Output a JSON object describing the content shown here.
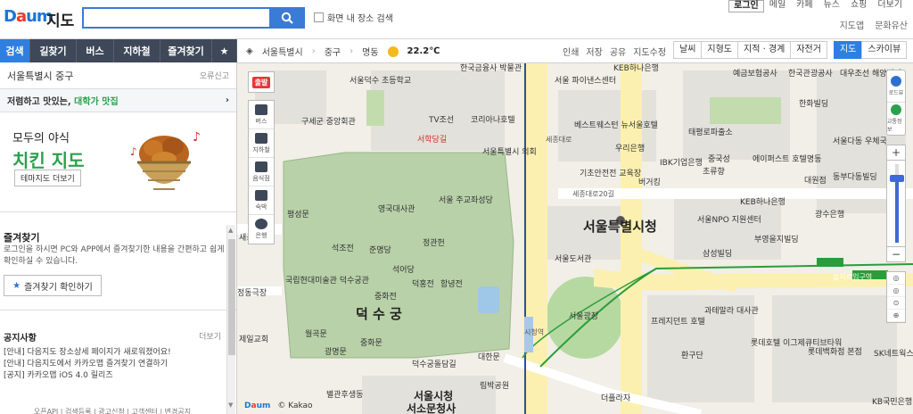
{
  "header": {
    "logo_text": "Daum",
    "title": "지도",
    "search": {
      "placeholder": "",
      "value": ""
    },
    "checkbox_label": "화면 내 장소 검색",
    "topnav": [
      "로그인",
      "메일",
      "카페",
      "뉴스",
      "쇼핑",
      "더보기"
    ],
    "topnav2": [
      "지도앱",
      "문화유산"
    ]
  },
  "lefttabs": [
    "검색",
    "길찾기",
    "버스",
    "지하철",
    "즐겨찾기"
  ],
  "leftpanel": {
    "location": "서울특별시 중구",
    "report": "오류신고",
    "promo_prefix": "저렴하고 맛있는, ",
    "promo_highlight": "대학가 맛집",
    "banner_line1": "모두의 야식",
    "banner_line2": "치킨 지도",
    "banner_button": "테마지도 더보기",
    "fav_title": "즐겨찾기",
    "fav_desc": "로그인을 하시면 PC와 APP에서 즐겨찾기한 내용을 간편하고 쉽게 확인하실 수 있습니다.",
    "fav_button": "즐겨찾기 확인하기",
    "notice_title": "공지사항",
    "notice_more": "더보기",
    "notices": [
      "[안내] 다음지도 장소상세 페이지가 새로워졌어요!",
      "[안내] 다음지도에서 카카오맵 즐겨찾기 연결하기",
      "[공지] 카카오맵 iOS 4.0 릴리즈"
    ],
    "footer": "오픈API | 검색등록 | 광고신청 | 고객센터 | 변경공지"
  },
  "toolbar": {
    "crumbs": [
      "서울특별시",
      "중구",
      "명동"
    ],
    "temperature": "22.2℃",
    "actions": [
      "인쇄",
      "저장",
      "공유",
      "지도수정"
    ],
    "layers": [
      "날씨",
      "지형도",
      "지적 · 경계",
      "자전거"
    ],
    "maptypes": [
      "지도",
      "스카이뷰"
    ]
  },
  "maptools": {
    "start_label": "출발",
    "items": [
      "버스",
      "지하철",
      "음식점",
      "숙박",
      "은행"
    ]
  },
  "zoomtools": {
    "roadview": "로드뷰",
    "traffic": "교통정보",
    "plus": "+",
    "minus": "−"
  },
  "map": {
    "labels": [
      {
        "id": "deoksugung",
        "text": "덕 수 궁",
        "cls": "big"
      },
      {
        "id": "cityhall",
        "text": "서울특별시청",
        "cls": "big"
      },
      {
        "id": "seoulcityhall_station",
        "text": "서울시청",
        "cls": "med"
      },
      {
        "id": "seosomun",
        "text": "서소문청사",
        "cls": "med"
      },
      {
        "id": "euljiro",
        "text": "을지로입구역",
        "cls": "road"
      },
      {
        "id": "hgbm",
        "text": "한국금융사 박물관",
        "cls": ""
      },
      {
        "id": "deoksu_school",
        "text": "서울덕수 초등학교",
        "cls": ""
      },
      {
        "id": "guse",
        "text": "구세군 중앙회관",
        "cls": ""
      },
      {
        "id": "tvchosun",
        "text": "TV조선",
        "cls": ""
      },
      {
        "id": "korea_press",
        "text": "코리아나호텔",
        "cls": ""
      },
      {
        "id": "seohakdanggil",
        "text": "서학당길",
        "cls": ""
      },
      {
        "id": "seoul_council",
        "text": "서울특별시 의회",
        "cls": ""
      },
      {
        "id": "finance_center",
        "text": "서울 파이낸스센터",
        "cls": ""
      },
      {
        "id": "kebhana",
        "text": "KEB하나은행",
        "cls": ""
      },
      {
        "id": "yegeum",
        "text": "예금보험공사",
        "cls": ""
      },
      {
        "id": "hankuk",
        "text": "한국관광공사",
        "cls": ""
      },
      {
        "id": "daewoo",
        "text": "대우조선 해양빌딩",
        "cls": ""
      },
      {
        "id": "hanwha",
        "text": "한화빌딩",
        "cls": ""
      },
      {
        "id": "westin",
        "text": "베스트웨스턴 뉴서울호텔",
        "cls": ""
      },
      {
        "id": "woori",
        "text": "우리은행",
        "cls": ""
      },
      {
        "id": "taepyeong",
        "text": "태평로파출소",
        "cls": ""
      },
      {
        "id": "kiki",
        "text": "기초안전전 교육장",
        "cls": ""
      },
      {
        "id": "ibk",
        "text": "IBK기업은행",
        "cls": ""
      },
      {
        "id": "burger",
        "text": "버거킹",
        "cls": ""
      },
      {
        "id": "joonggukseong",
        "text": "중국성",
        "cls": ""
      },
      {
        "id": "chorongbang",
        "text": "초류향",
        "cls": ""
      },
      {
        "id": "ace",
        "text": "에이퍼스트 호텔명동",
        "cls": ""
      },
      {
        "id": "seoul_dadong",
        "text": "서울다동 우체국",
        "cls": ""
      },
      {
        "id": "dongbu",
        "text": "동부다동빌딩",
        "cls": ""
      },
      {
        "id": "daewon",
        "text": "대원점",
        "cls": ""
      },
      {
        "id": "sejong20",
        "text": "세종대로20길",
        "cls": "road"
      },
      {
        "id": "kebhana2",
        "text": "KEB하나은행",
        "cls": ""
      },
      {
        "id": "gwangsu",
        "text": "광수은행",
        "cls": ""
      },
      {
        "id": "yeongguk",
        "text": "영국대사관",
        "cls": ""
      },
      {
        "id": "seoul_jugyo",
        "text": "서울 주교좌성당",
        "cls": ""
      },
      {
        "id": "jeonggwanheon",
        "text": "정관헌",
        "cls": ""
      },
      {
        "id": "seokjojeon",
        "text": "석조전",
        "cls": ""
      },
      {
        "id": "junmyeongdang",
        "text": "준명당",
        "cls": ""
      },
      {
        "id": "seokeodang",
        "text": "석어당",
        "cls": ""
      },
      {
        "id": "deokhongjeon",
        "text": "덕홍전",
        "cls": ""
      },
      {
        "id": "hamnyeongjeon",
        "text": "함녕전",
        "cls": ""
      },
      {
        "id": "junghwajeon",
        "text": "중화전",
        "cls": ""
      },
      {
        "id": "junghwamun",
        "text": "중화문",
        "cls": ""
      },
      {
        "id": "gwangmyeongmun",
        "text": "광명문",
        "cls": ""
      },
      {
        "id": "daehanmun",
        "text": "대한문",
        "cls": ""
      },
      {
        "id": "deoksu_dam",
        "text": "덕수궁돌담길",
        "cls": ""
      },
      {
        "id": "museum",
        "text": "국립현대미술관 덕수궁관",
        "cls": ""
      },
      {
        "id": "pyeongsungmun",
        "text": "평성문",
        "cls": ""
      },
      {
        "id": "woongmun",
        "text": "월곡문",
        "cls": ""
      },
      {
        "id": "jeong",
        "text": "정동극장",
        "cls": ""
      },
      {
        "id": "jeil",
        "text": "제일교회",
        "cls": ""
      },
      {
        "id": "saegong",
        "text": "새공사관",
        "cls": ""
      },
      {
        "id": "seoul_library",
        "text": "서울도서관",
        "cls": ""
      },
      {
        "id": "seoul_plaza",
        "text": "서울광장",
        "cls": ""
      },
      {
        "id": "npo",
        "text": "서울NPO 지원센터",
        "cls": ""
      },
      {
        "id": "buyoung",
        "text": "부영을지빌딩",
        "cls": ""
      },
      {
        "id": "samsung",
        "text": "삼성빌딩",
        "cls": ""
      },
      {
        "id": "plaza",
        "text": "프레지던트 호텔",
        "cls": ""
      },
      {
        "id": "gwacheon",
        "text": "과테말라 대사관",
        "cls": ""
      },
      {
        "id": "hwangudan",
        "text": "환구단",
        "cls": ""
      },
      {
        "id": "lotte_hotel",
        "text": "롯데호텔 이그제큐티브타워",
        "cls": ""
      },
      {
        "id": "lotte_dept",
        "text": "롯데백화점 본점",
        "cls": ""
      },
      {
        "id": "kb",
        "text": "KB국민은행",
        "cls": ""
      },
      {
        "id": "sk",
        "text": "SK네트웍스",
        "cls": ""
      },
      {
        "id": "deoksuhotel",
        "text": "더플라자",
        "cls": ""
      },
      {
        "id": "rimbak",
        "text": "림박공원",
        "cls": ""
      },
      {
        "id": "byeol",
        "text": "별관후생동",
        "cls": ""
      },
      {
        "id": "seoulcity_road",
        "text": "시청역",
        "cls": "road"
      },
      {
        "id": "taepyeongro",
        "text": "세종대로",
        "cls": "road"
      }
    ]
  },
  "copyright": {
    "brand": "Daum",
    "kakao": "© Kakao"
  }
}
